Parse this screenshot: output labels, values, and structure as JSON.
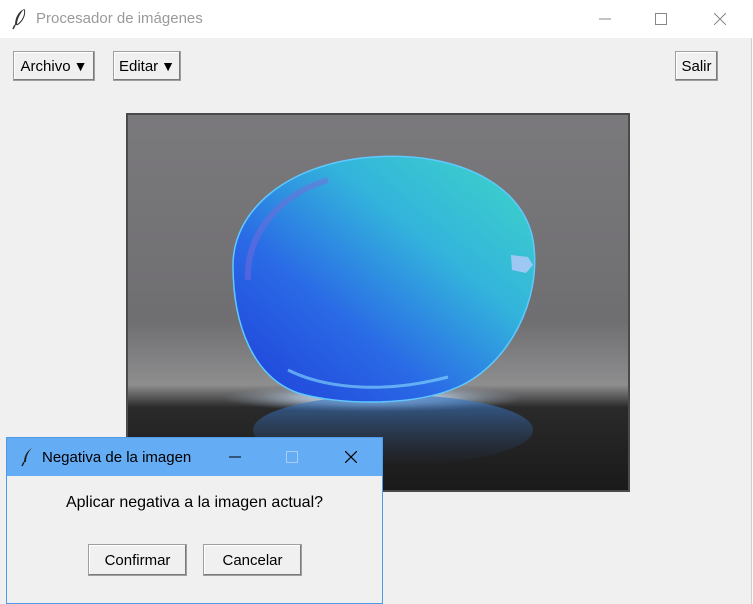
{
  "main_window": {
    "title": "Procesador de imágenes",
    "icon": "feather-icon",
    "menu": {
      "archivo_label": "Archivo",
      "editar_label": "Editar",
      "arrow": "▼",
      "salir_label": "Salir"
    }
  },
  "dialog": {
    "title": "Negativa de la imagen",
    "icon": "feather-icon",
    "message": "Aplicar negativa a la imagen actual?",
    "confirm_label": "Confirmar",
    "cancel_label": "Cancelar"
  },
  "colors": {
    "window_bg": "#f0f0f0",
    "dialog_titlebar": "#64acf3",
    "mango_blue": "#2a5fe0",
    "mango_cyan": "#3fc7d6"
  }
}
